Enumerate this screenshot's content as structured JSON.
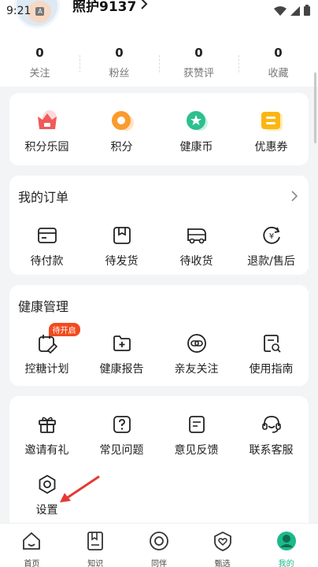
{
  "status_bar": {
    "time": "9:21",
    "notif_badge": "A"
  },
  "profile": {
    "name": "照护9137"
  },
  "stats": [
    {
      "value": "0",
      "label": "关注"
    },
    {
      "value": "0",
      "label": "粉丝"
    },
    {
      "value": "0",
      "label": "获赞评"
    },
    {
      "value": "0",
      "label": "收藏"
    }
  ],
  "rewards": [
    {
      "label": "积分乐园",
      "icon": "gift-crown-icon"
    },
    {
      "label": "积分",
      "icon": "points-icon"
    },
    {
      "label": "健康币",
      "icon": "health-coin-icon"
    },
    {
      "label": "优惠券",
      "icon": "coupon-icon"
    }
  ],
  "orders": {
    "title": "我的订单",
    "items": [
      {
        "label": "待付款",
        "icon": "wallet-icon"
      },
      {
        "label": "待发货",
        "icon": "package-icon"
      },
      {
        "label": "待收货",
        "icon": "truck-icon"
      },
      {
        "label": "退款/售后",
        "icon": "refund-icon"
      }
    ]
  },
  "health": {
    "title": "健康管理",
    "badge": "待开启",
    "items": [
      {
        "label": "控糖计划",
        "icon": "plan-icon"
      },
      {
        "label": "健康报告",
        "icon": "report-folder-icon"
      },
      {
        "label": "亲友关注",
        "icon": "link-icon"
      },
      {
        "label": "使用指南",
        "icon": "guide-icon"
      }
    ]
  },
  "services": {
    "items": [
      {
        "label": "邀请有礼",
        "icon": "gift-icon"
      },
      {
        "label": "常见问题",
        "icon": "question-icon"
      },
      {
        "label": "意见反馈",
        "icon": "feedback-icon"
      },
      {
        "label": "联系客服",
        "icon": "headset-icon"
      },
      {
        "label": "设置",
        "icon": "settings-icon"
      }
    ]
  },
  "bottom_nav": [
    {
      "label": "首页",
      "icon": "home-icon"
    },
    {
      "label": "知识",
      "icon": "book-icon"
    },
    {
      "label": "同伴",
      "icon": "companion-icon"
    },
    {
      "label": "甄选",
      "icon": "heart-shield-icon"
    },
    {
      "label": "我的",
      "icon": "me-icon",
      "active": true
    }
  ],
  "colors": {
    "accent": "#1cb98a",
    "badge": "#f24a1d",
    "annotation_arrow": "#e53935"
  }
}
